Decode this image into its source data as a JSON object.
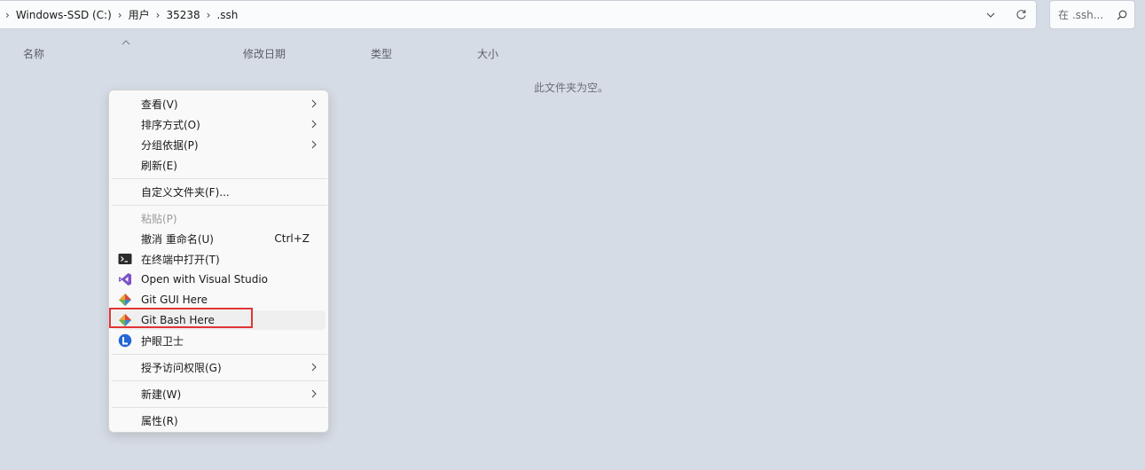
{
  "address_bar": {
    "breadcrumbs": [
      "Windows-SSD (C:)",
      "用户",
      "35238",
      ".ssh"
    ],
    "dropdown_icon": "chevron-down-icon",
    "refresh_icon": "refresh-icon"
  },
  "search": {
    "placeholder": "在 .ssh..."
  },
  "columns": [
    "名称",
    "修改日期",
    "类型",
    "大小"
  ],
  "empty_message": "此文件夹为空。",
  "context_menu": {
    "items": [
      {
        "label": "查看(V)",
        "submenu": true
      },
      {
        "label": "排序方式(O)",
        "submenu": true
      },
      {
        "label": "分组依据(P)",
        "submenu": true
      },
      {
        "label": "刷新(E)"
      },
      {
        "label": "自定义文件夹(F)..."
      },
      {
        "label": "粘贴(P)",
        "disabled": true
      },
      {
        "label": "撤消 重命名(U)",
        "shortcut": "Ctrl+Z"
      },
      {
        "label": "在终端中打开(T)",
        "icon": "terminal-icon"
      },
      {
        "label": "Open with Visual Studio",
        "icon": "visual-studio-icon"
      },
      {
        "label": "Git GUI Here",
        "icon": "git-icon"
      },
      {
        "label": "Git Bash Here",
        "icon": "git-icon",
        "highlighted": true
      },
      {
        "label": "护眼卫士",
        "icon": "eye-guard-icon"
      },
      {
        "label": "授予访问权限(G)",
        "submenu": true
      },
      {
        "label": "新建(W)",
        "submenu": true
      },
      {
        "label": "属性(R)"
      }
    ]
  },
  "colors": {
    "background": "#d6dce6",
    "highlight_border": "#e03535",
    "vs_purple": "#7b52c9"
  }
}
